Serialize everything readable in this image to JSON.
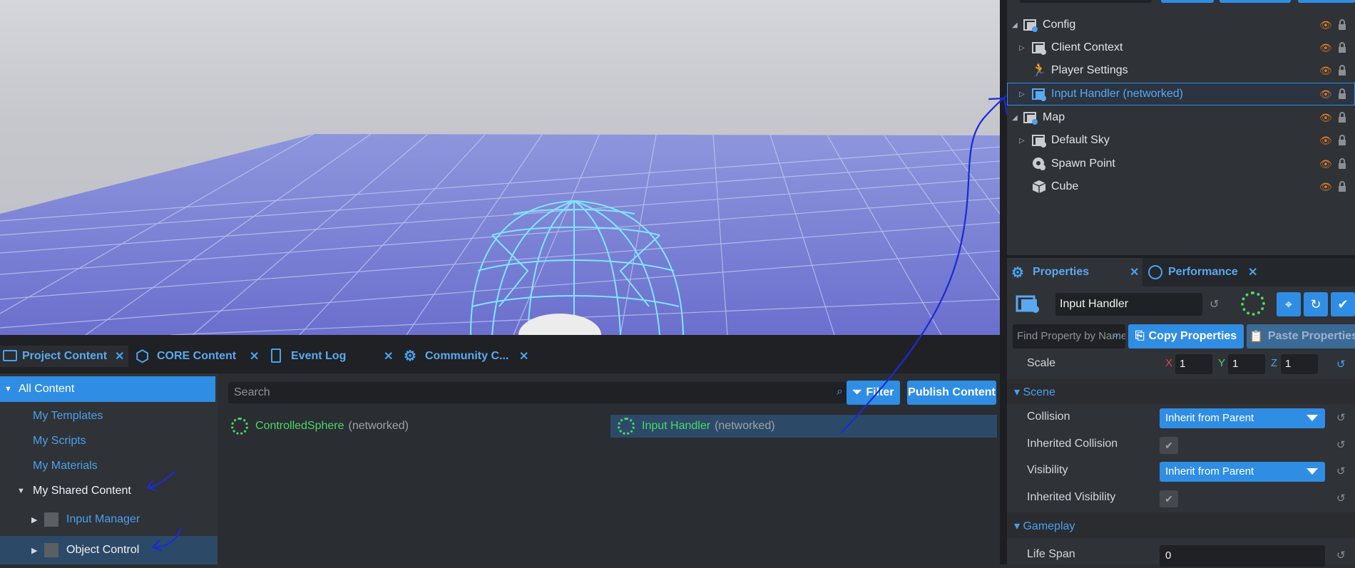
{
  "hierarchy": {
    "items": [
      {
        "label": "Config",
        "icon": "folder-network-icon"
      },
      {
        "label": "Client Context",
        "icon": "folder-network-icon"
      },
      {
        "label": "Player Settings",
        "icon": "player-settings-icon"
      },
      {
        "label": "Input Handler (networked)",
        "icon": "folder-network-icon"
      },
      {
        "label": "Map",
        "icon": "folder-network-icon"
      },
      {
        "label": "Default Sky",
        "icon": "folder-network-icon"
      },
      {
        "label": "Spawn Point",
        "icon": "spawn-point-icon"
      },
      {
        "label": "Cube",
        "icon": "cube-icon"
      }
    ]
  },
  "properties": {
    "tabs": [
      {
        "label": "Properties"
      },
      {
        "label": "Performance"
      }
    ],
    "name_value": "Input Handler",
    "search_placeholder": "Find Property by Name",
    "copy_label": "Copy Properties",
    "paste_label": "Paste Properties",
    "scale": {
      "label": "Scale",
      "x": "1",
      "y": "1",
      "z": "1"
    },
    "sections": {
      "scene": "Scene",
      "gameplay": "Gameplay"
    },
    "collision": {
      "label": "Collision",
      "value": "Inherit from Parent"
    },
    "inherited_collision": {
      "label": "Inherited Collision"
    },
    "visibility": {
      "label": "Visibility",
      "value": "Inherit from Parent"
    },
    "inherited_visibility": {
      "label": "Inherited Visibility"
    },
    "life_span": {
      "label": "Life Span",
      "value": "0"
    }
  },
  "bottom_tabs": [
    {
      "label": "Project Content"
    },
    {
      "label": "CORE Content"
    },
    {
      "label": "Event Log"
    },
    {
      "label": "Community C..."
    }
  ],
  "tree": {
    "all_content": "All Content",
    "my_templates": "My Templates",
    "my_scripts": "My Scripts",
    "my_materials": "My Materials",
    "my_shared_content": "My Shared Content",
    "input_manager": "Input Manager",
    "object_control": "Object Control"
  },
  "assets": {
    "search_placeholder": "Search",
    "filter_label": "Filter",
    "publish_label": "Publish Content",
    "items": [
      {
        "name": "ControlledSphere",
        "tag": "(networked)"
      },
      {
        "name": "Input Handler",
        "tag": "(networked)"
      }
    ]
  },
  "colors": {
    "accent": "#2f8de4",
    "eye": "#e07a2a",
    "asset_green": "#4cd66a",
    "annotation": "#1a2bd6"
  }
}
